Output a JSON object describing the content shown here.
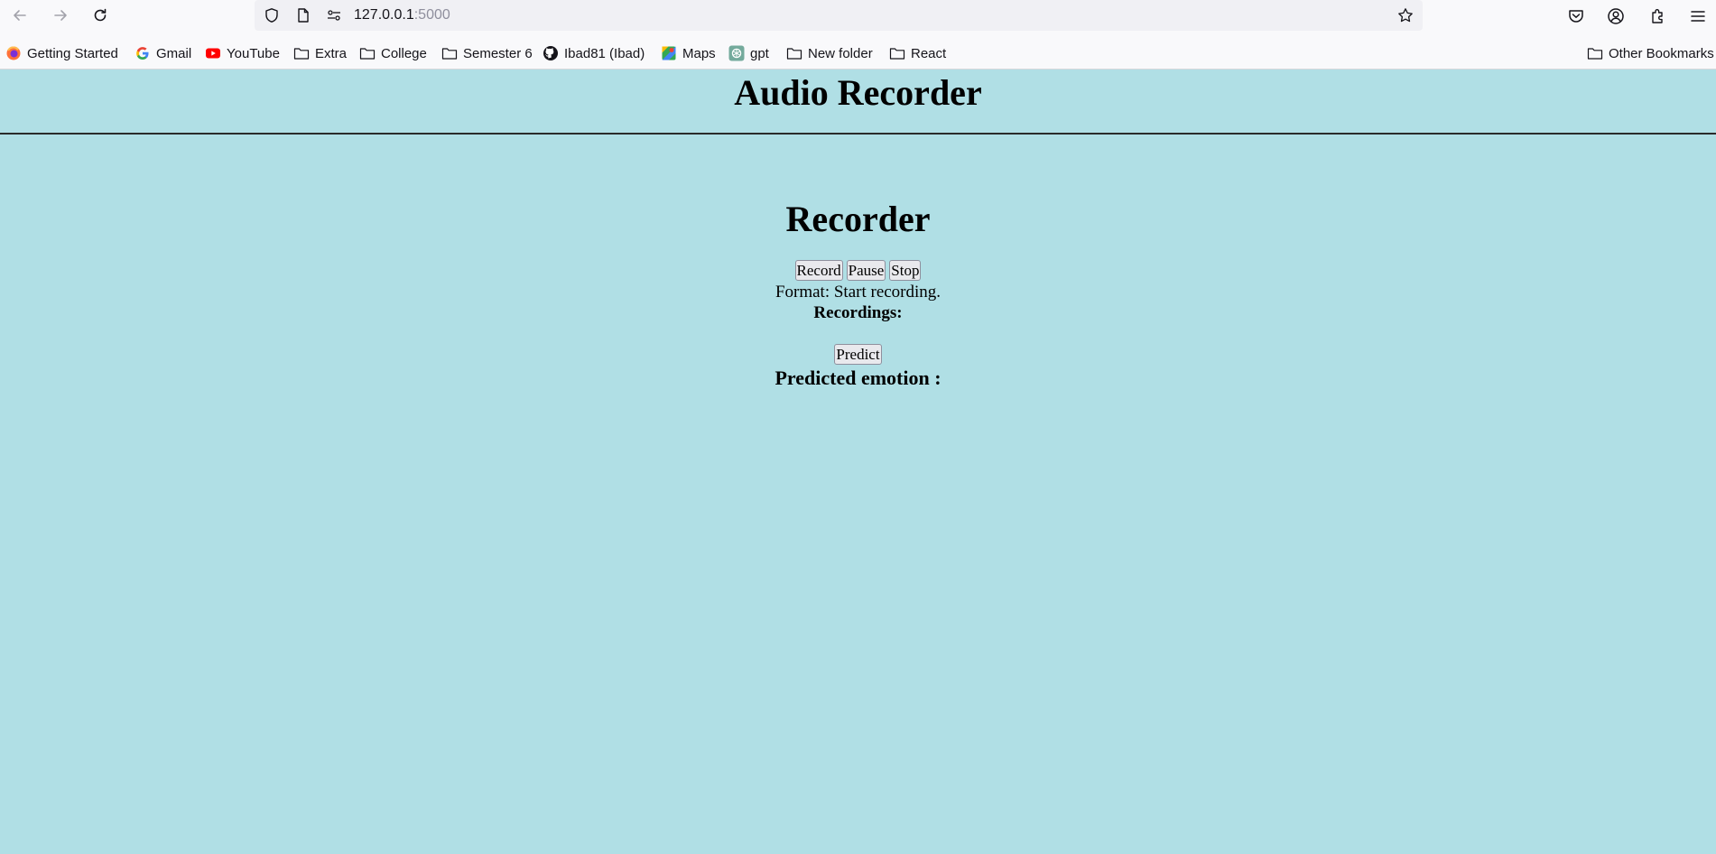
{
  "browser": {
    "url_host": "127.0.0.1",
    "url_port": ":5000",
    "bookmarks": [
      {
        "label": "Getting Started",
        "icon": "firefox-icon"
      },
      {
        "label": "Gmail",
        "icon": "google-icon"
      },
      {
        "label": "YouTube",
        "icon": "youtube-icon"
      },
      {
        "label": "Extra",
        "icon": "folder-icon"
      },
      {
        "label": "College",
        "icon": "folder-icon"
      },
      {
        "label": "Semester 6",
        "icon": "folder-icon"
      },
      {
        "label": "Ibad81 (Ibad)",
        "icon": "github-icon"
      },
      {
        "label": "Maps",
        "icon": "maps-icon"
      },
      {
        "label": "gpt",
        "icon": "chatgpt-icon"
      },
      {
        "label": "New folder",
        "icon": "folder-icon"
      },
      {
        "label": "React",
        "icon": "folder-icon"
      }
    ],
    "other_bookmarks": "Other Bookmarks"
  },
  "page": {
    "title": "Audio Recorder",
    "recorder_heading": "Recorder",
    "buttons": {
      "record": "Record",
      "pause": "Pause",
      "stop": "Stop"
    },
    "format_text": "Format: Start recording.",
    "recordings_label": "Recordings:",
    "predict_button": "Predict",
    "predicted_emotion_label": "Predicted emotion :"
  },
  "colors": {
    "page_background": "#b0dfe5",
    "chrome_background": "#f9f9fb"
  }
}
